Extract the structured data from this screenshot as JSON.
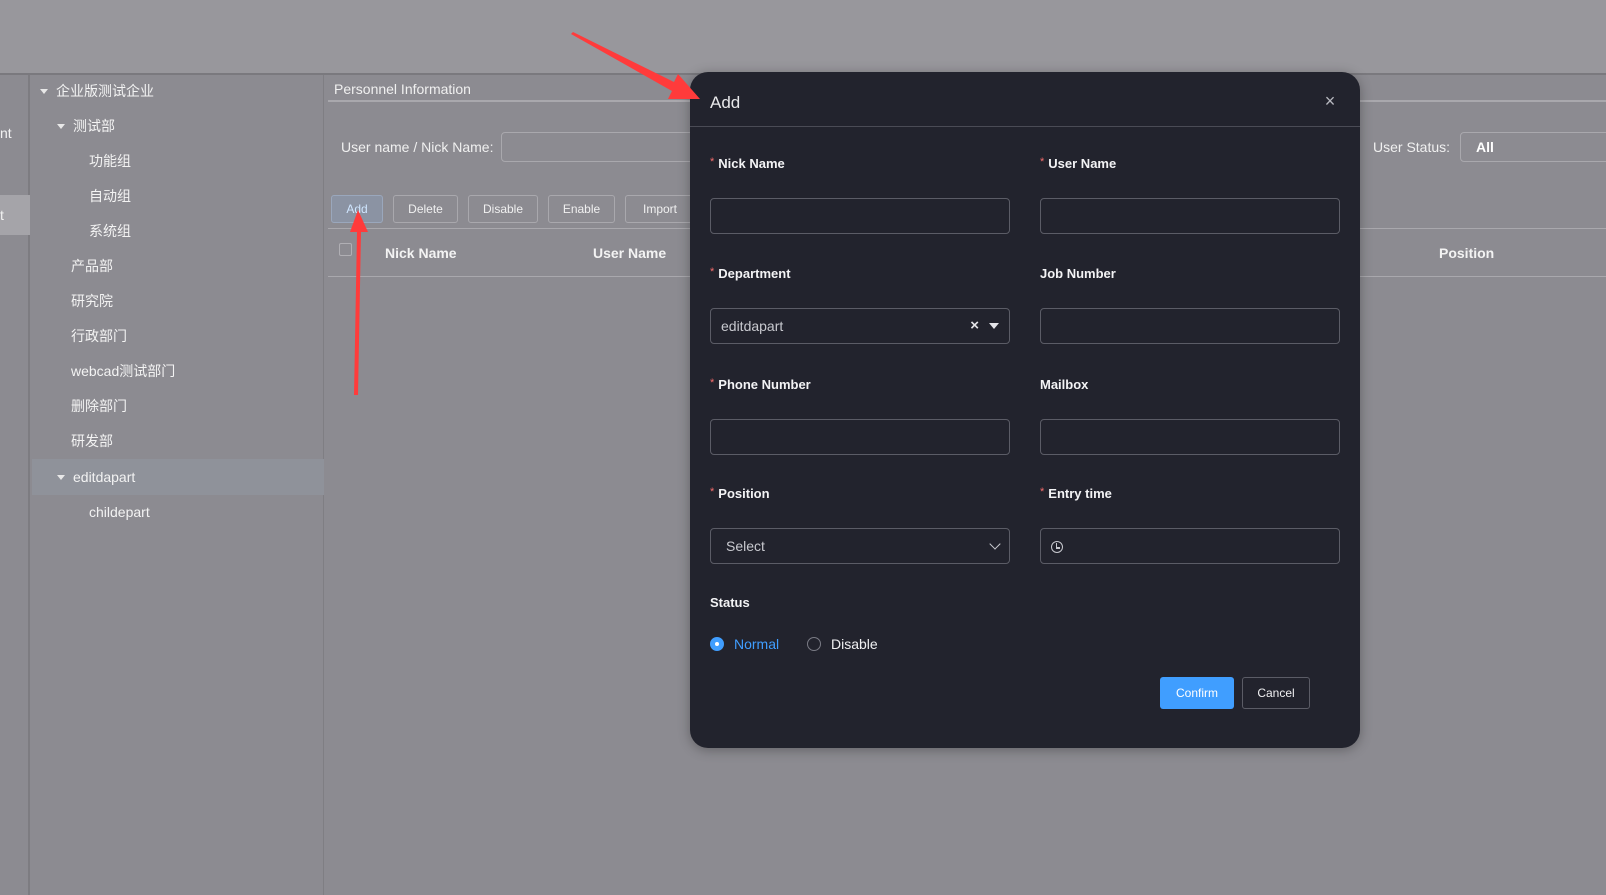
{
  "left_nav": {
    "items": [
      {
        "label": "nt"
      },
      {
        "label": "t",
        "active": true
      }
    ]
  },
  "tree": {
    "items": [
      {
        "label": "企业版测试企业",
        "level": 0,
        "expanded": true
      },
      {
        "label": "测试部",
        "level": 1,
        "expanded": true
      },
      {
        "label": "功能组",
        "level": 2
      },
      {
        "label": "自动组",
        "level": 2
      },
      {
        "label": "系统组",
        "level": 2
      },
      {
        "label": "产品部",
        "level": 1
      },
      {
        "label": "研究院",
        "level": 1
      },
      {
        "label": "行政部门",
        "level": 1
      },
      {
        "label": "webcad测试部门",
        "level": 1
      },
      {
        "label": "删除部门",
        "level": 1
      },
      {
        "label": "研发部",
        "level": 1
      },
      {
        "label": "editdapart",
        "level": 1,
        "expanded": true,
        "selected": true
      },
      {
        "label": "childepart",
        "level": 2
      }
    ]
  },
  "main": {
    "section_title": "Personnel Information",
    "filters": {
      "username_label": "User name / Nick Name:",
      "username_value": "",
      "status_label": "User Status:",
      "status_value": "All"
    },
    "toolbar": {
      "add": "Add",
      "delete": "Delete",
      "disable": "Disable",
      "enable": "Enable",
      "import": "Import"
    },
    "table": {
      "columns": [
        "Nick Name",
        "User Name",
        "Position"
      ]
    }
  },
  "modal": {
    "title": "Add",
    "fields": {
      "nick_name": {
        "label": "Nick Name",
        "required": true,
        "value": ""
      },
      "user_name": {
        "label": "User Name",
        "required": true,
        "value": ""
      },
      "department": {
        "label": "Department",
        "required": true,
        "value": "editdapart"
      },
      "job_number": {
        "label": "Job Number",
        "required": false,
        "value": ""
      },
      "phone_number": {
        "label": "Phone Number",
        "required": true,
        "value": ""
      },
      "mailbox": {
        "label": "Mailbox",
        "required": false,
        "value": ""
      },
      "position": {
        "label": "Position",
        "required": true,
        "placeholder": "Select"
      },
      "entry_time": {
        "label": "Entry time",
        "required": true,
        "value": ""
      }
    },
    "status": {
      "label": "Status",
      "options": [
        "Normal",
        "Disable"
      ],
      "selected": "Normal"
    },
    "confirm": "Confirm",
    "cancel": "Cancel",
    "required_marker": "*",
    "close_glyph": "×",
    "clear_glyph": "×"
  },
  "colors": {
    "accent": "#409eff",
    "required": "#f56c6c",
    "modal_bg": "#22232d",
    "annotation_arrow": "#ff3b3b"
  }
}
